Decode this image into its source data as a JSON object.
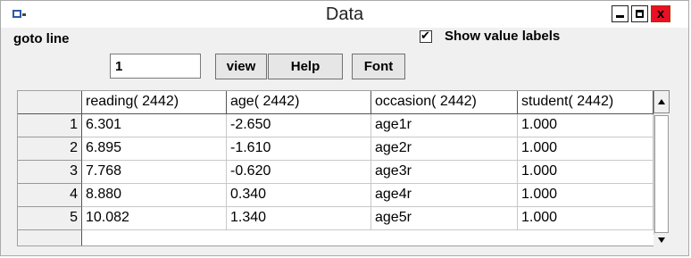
{
  "window": {
    "title": "Data",
    "controls": {
      "minimize": "minimize",
      "maximize": "maximize",
      "close": "x"
    }
  },
  "toolbar": {
    "goto_label": "goto line",
    "goto_value": "1",
    "view_label": "view",
    "help_label": "Help",
    "font_label": "Font",
    "show_value_labels": "Show value labels",
    "show_value_labels_checked": true
  },
  "table": {
    "columns": [
      "reading( 2442)",
      "age( 2442)",
      "occasion( 2442)",
      "student( 2442)"
    ],
    "rows": [
      {
        "n": "1",
        "cells": [
          "6.301",
          "-2.650",
          "age1r",
          "1.000"
        ]
      },
      {
        "n": "2",
        "cells": [
          "6.895",
          "-1.610",
          "age2r",
          "1.000"
        ]
      },
      {
        "n": "3",
        "cells": [
          "7.768",
          "-0.620",
          "age3r",
          "1.000"
        ]
      },
      {
        "n": "4",
        "cells": [
          "8.880",
          "0.340",
          "age4r",
          "1.000"
        ]
      },
      {
        "n": "5",
        "cells": [
          "10.082",
          "1.340",
          "age5r",
          "1.000"
        ]
      }
    ]
  }
}
